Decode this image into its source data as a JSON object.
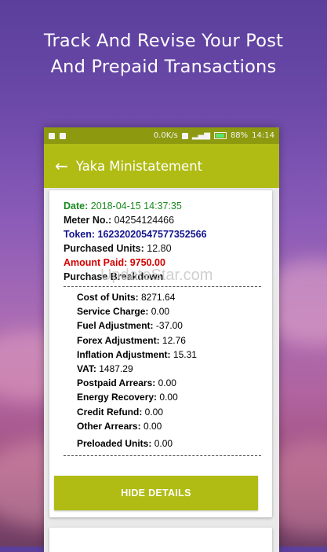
{
  "headline": {
    "line1": "Track And Revise Your Post",
    "line2": "And Prepaid Transactions"
  },
  "status_bar": {
    "speed": "0.0K/s",
    "battery": "88%",
    "time": "14:14"
  },
  "app_bar": {
    "back_icon": "arrow-left-icon",
    "title": "Yaka Ministatement"
  },
  "statement": {
    "date_label": "Date:",
    "date_value": "2018-04-15 14:37:35",
    "meter_label": "Meter No.:",
    "meter_value": "04254124466",
    "token_label": "Token:",
    "token_value": "16232020547577352566",
    "units_label": "Purchased Units:",
    "units_value": "12.80",
    "amount_label": "Amount Paid:",
    "amount_value": "9750.00",
    "breakdown_title": "Purchase Breakdown",
    "breakdown": [
      {
        "label": "Cost of Units:",
        "value": "8271.64"
      },
      {
        "label": "Service Charge:",
        "value": "0.00"
      },
      {
        "label": "Fuel Adjustment:",
        "value": "-37.00"
      },
      {
        "label": "Forex Adjustment:",
        "value": "12.76"
      },
      {
        "label": "Inflation Adjustment:",
        "value": "15.31"
      },
      {
        "label": "VAT:",
        "value": "1487.29"
      },
      {
        "label": "Postpaid Arrears:",
        "value": "0.00"
      },
      {
        "label": "Energy Recovery:",
        "value": "0.00"
      },
      {
        "label": "Credit Refund:",
        "value": "0.00"
      },
      {
        "label": "Other Arrears:",
        "value": "0.00"
      }
    ],
    "preloaded_label": "Preloaded Units:",
    "preloaded_value": "0.00"
  },
  "button": {
    "hide_details": "HIDE DETAILS"
  },
  "watermark": "UpdateStar.com",
  "colors": {
    "accent": "#b0bc14",
    "status_bar": "#8d9a10",
    "date_green": "#1b8a1f",
    "token_blue": "#14148f",
    "amount_red": "#d40000"
  }
}
